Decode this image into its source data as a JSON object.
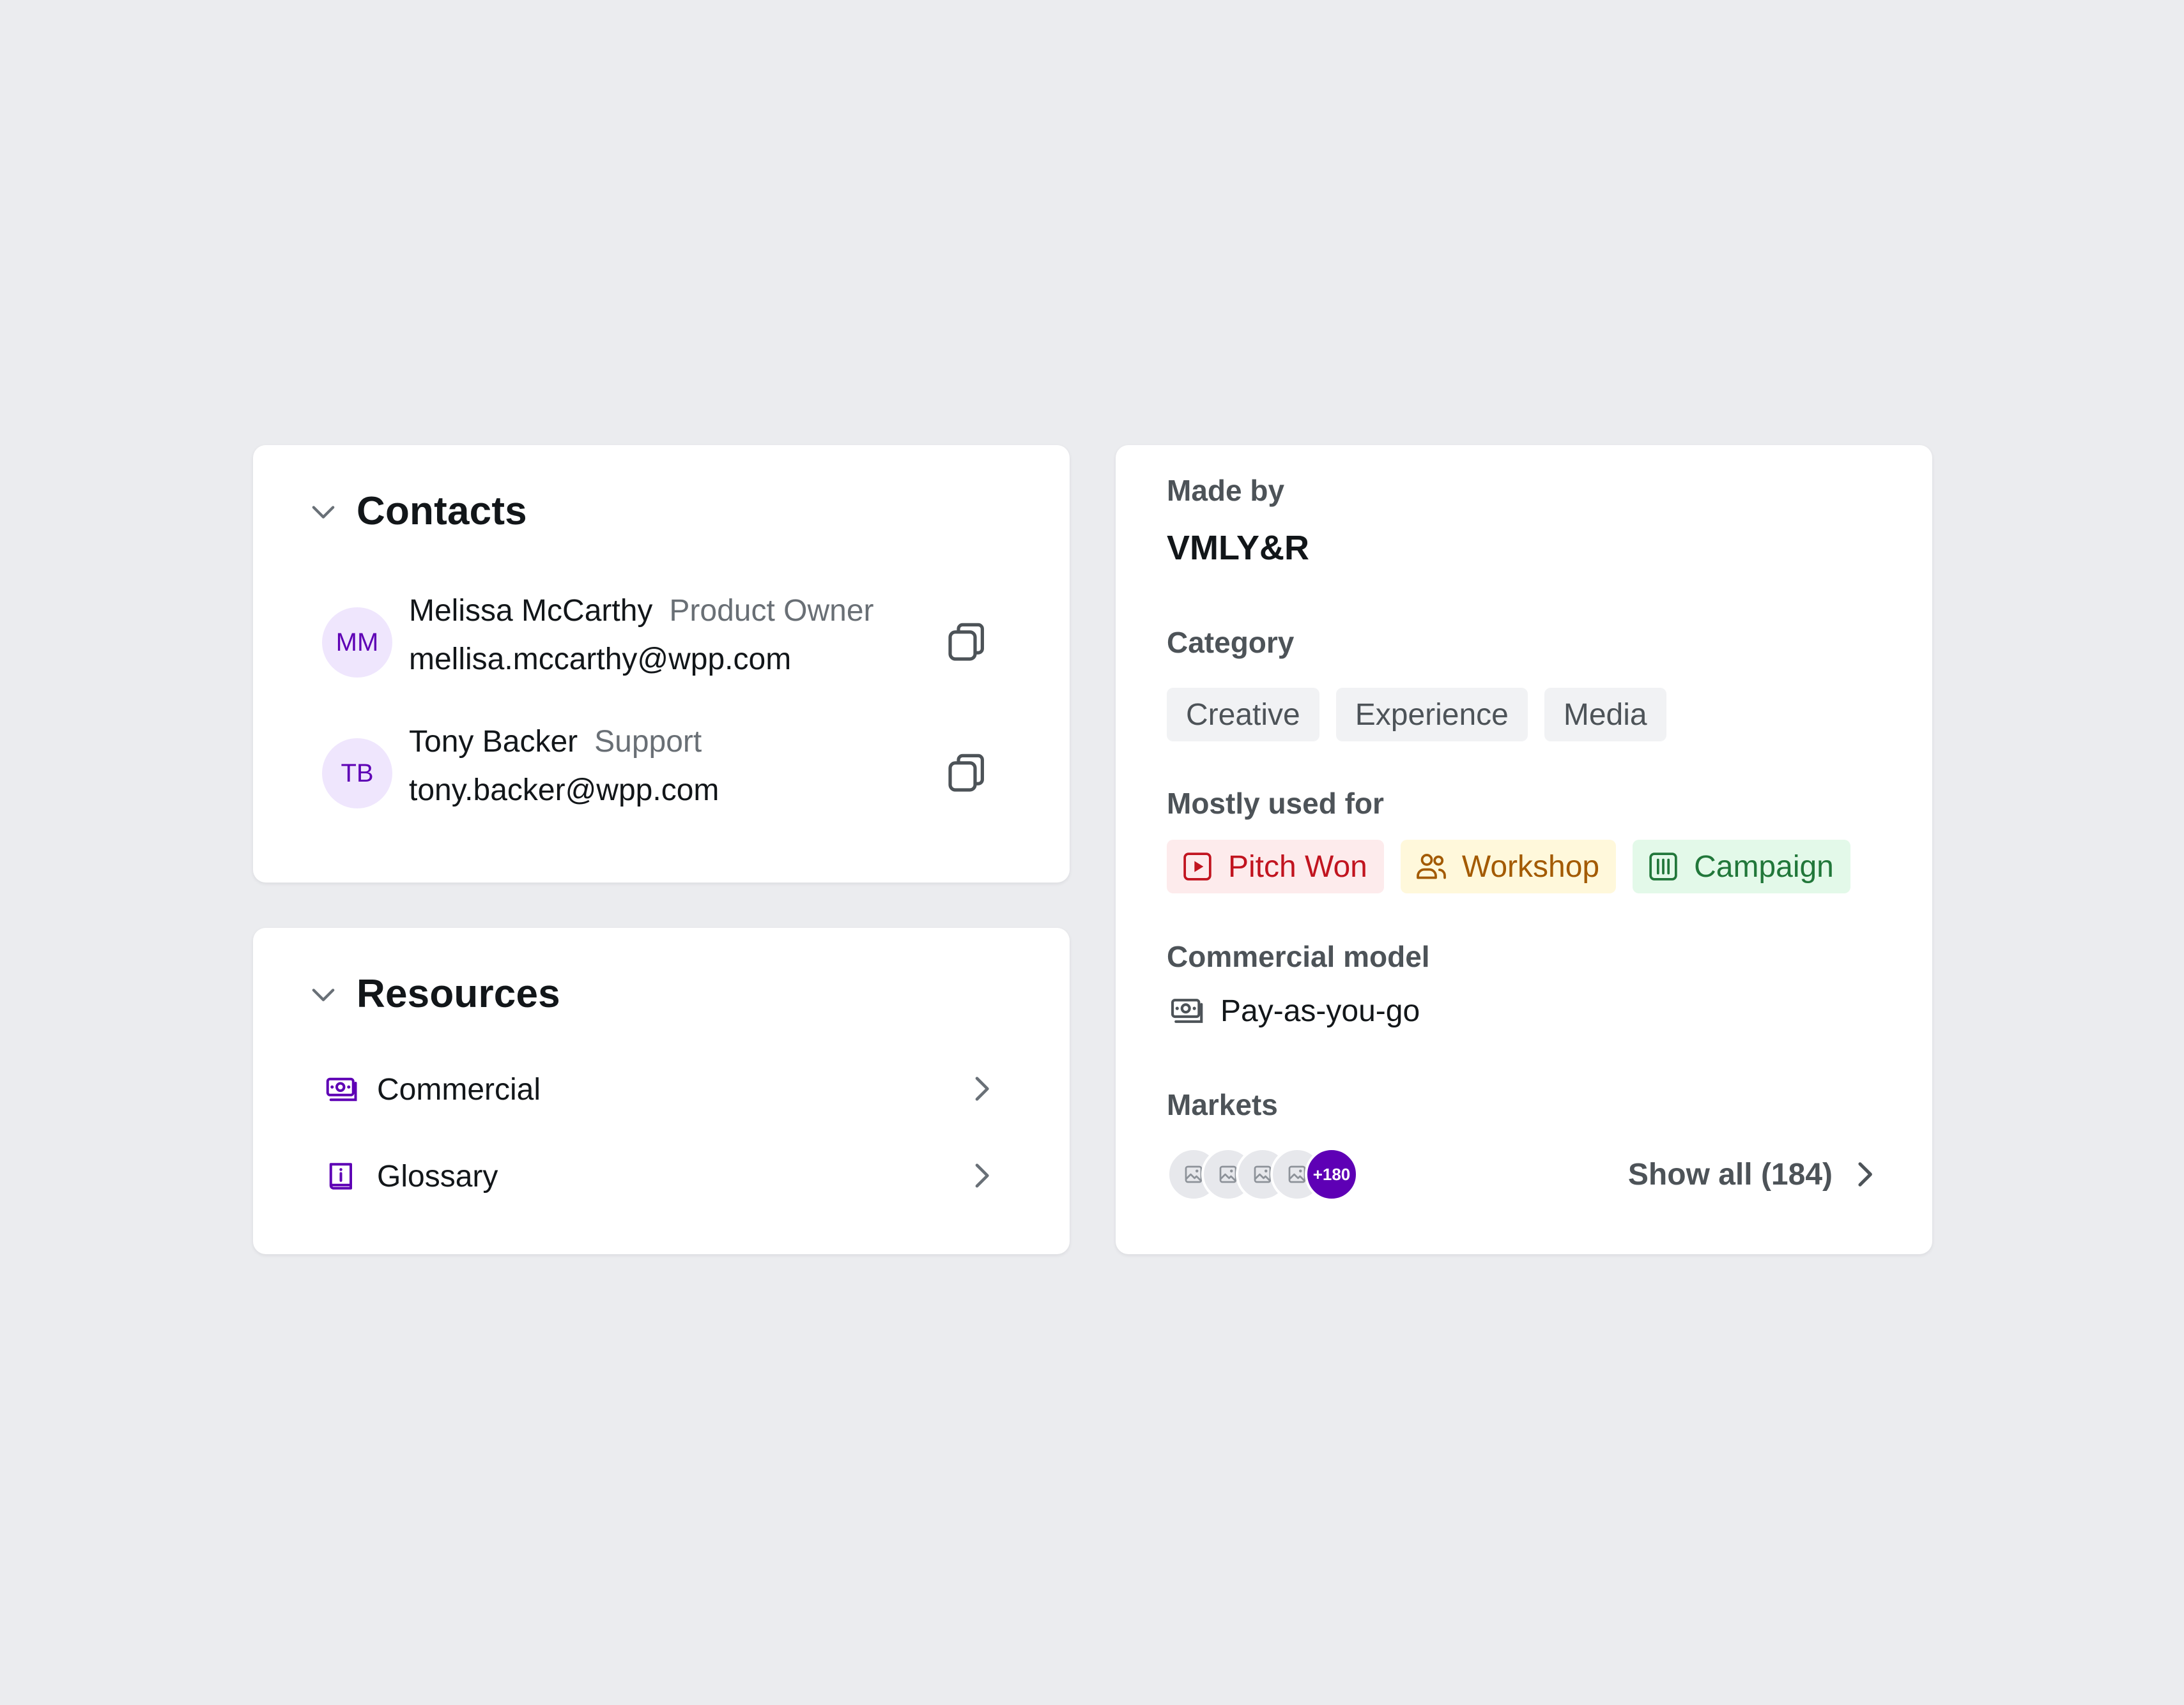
{
  "contacts": {
    "title": "Contacts",
    "items": [
      {
        "initials": "MM",
        "name": "Melissa McCarthy",
        "role": "Product Owner",
        "email": "mellisa.mccarthy@wpp.com"
      },
      {
        "initials": "TB",
        "name": "Tony Backer",
        "role": "Support",
        "email": "tony.backer@wpp.com"
      }
    ]
  },
  "resources": {
    "title": "Resources",
    "items": [
      {
        "label": "Commercial",
        "icon": "money-icon"
      },
      {
        "label": "Glossary",
        "icon": "book-info-icon"
      }
    ]
  },
  "details": {
    "made_by_label": "Made by",
    "made_by_value": "VMLY&R",
    "category_label": "Category",
    "categories": [
      "Creative",
      "Experience",
      "Media"
    ],
    "used_for_label": "Mostly used for",
    "used_for": [
      {
        "label": "Pitch Won",
        "icon": "play-icon",
        "color": "#C1141F",
        "bg": "#FDEBEC"
      },
      {
        "label": "Workshop",
        "icon": "users-icon",
        "color": "#A35A00",
        "bg": "#FFF8DB"
      },
      {
        "label": "Campaign",
        "icon": "columns-icon",
        "color": "#21773A",
        "bg": "#E3F9E9"
      }
    ],
    "commercial_model_label": "Commercial model",
    "commercial_model_value": "Pay-as-you-go",
    "markets_label": "Markets",
    "markets_more": "+180",
    "show_all_label": "Show all (184)"
  },
  "colors": {
    "accent": "#5E00B5",
    "avatar_bg": "#EFE6FD",
    "page_bg": "#EBECEF",
    "card_bg": "#FFFFFF"
  }
}
